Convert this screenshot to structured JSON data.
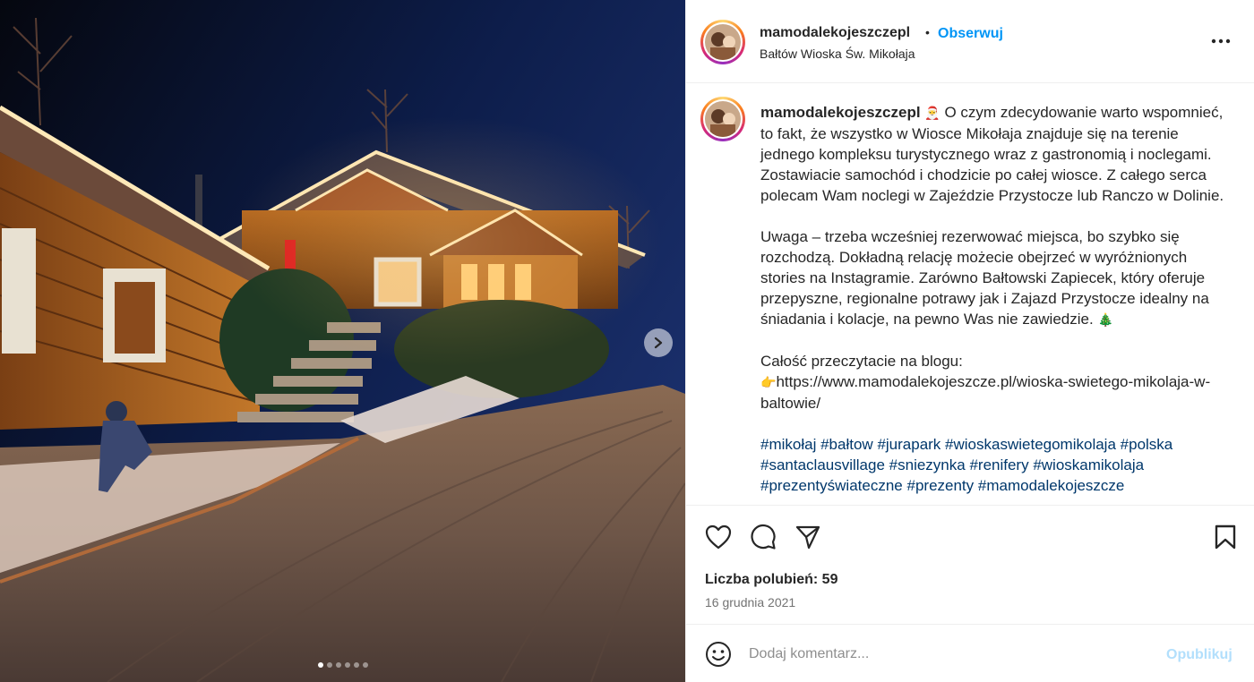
{
  "colors": {
    "accent": "#0095f6",
    "link": "#00376b",
    "muted": "#737373",
    "publish_disabled": "#b2dffc"
  },
  "photo": {
    "alt_icon": "photo-of-wooden-cabin-village-at-night",
    "next_icon": "chevron-right-icon",
    "carousel": {
      "count": 6,
      "active_index": 0
    }
  },
  "header": {
    "username": "mamodalekojeszczepl",
    "separator": "•",
    "follow_label": "Obserwuj",
    "location": "Bałtów Wioska Św. Mikołaja",
    "more_icon": "more-options-icon"
  },
  "caption": {
    "username": "mamodalekojeszczepl",
    "emoji_1": "🎅",
    "para1": "O czym zdecydowanie warto wspomnieć, to fakt, że wszystko w Wiosce Mikołaja znajduje się na terenie jednego kompleksu turystycznego wraz z gastronomią i noclegami. Zostawiacie samochód i chodzicie po całej wiosce. Z całego serca polecam Wam noclegi w Zajeździe Przystocze lub Ranczo w Dolinie.",
    "para2": "Uwaga – trzeba wcześniej rezerwować miejsca, bo szybko się rozchodzą. Dokładną relację możecie obejrzeć w wyróżnionych stories na Instagramie. Zarówno Bałtowski Zapiecek, który oferuje przepyszne, regionalne potrawy jak i Zajazd Przystocze idealny na śniadania i kolacje, na pewno Was nie zawiedzie.",
    "emoji_2": "🎄",
    "para3_intro": "Całość przeczytacie na blogu:",
    "emoji_3": "👉",
    "link": "https://www.mamodalekojeszcze.pl/wioska-swietego-mikolaja-w-baltowie/",
    "hashtags": [
      "#mikołaj",
      "#bałtow",
      "#jurapark",
      "#wioskaswietegomikolaja",
      "#polska",
      "#santaclausvillage",
      "#sniezynka",
      "#renifery",
      "#wioskamikolaja",
      "#prezentyświateczne",
      "#prezenty",
      "#mamodalekojeszcze"
    ]
  },
  "actions": {
    "like_icon": "heart-icon",
    "comment_icon": "comment-icon",
    "share_icon": "share-icon",
    "save_icon": "bookmark-icon",
    "likes_text": "Liczba polubień: 59",
    "date": "16 grudnia 2021"
  },
  "comment": {
    "emoji_icon": "smiley-icon",
    "placeholder": "Dodaj komentarz...",
    "publish_label": "Opublikuj"
  }
}
